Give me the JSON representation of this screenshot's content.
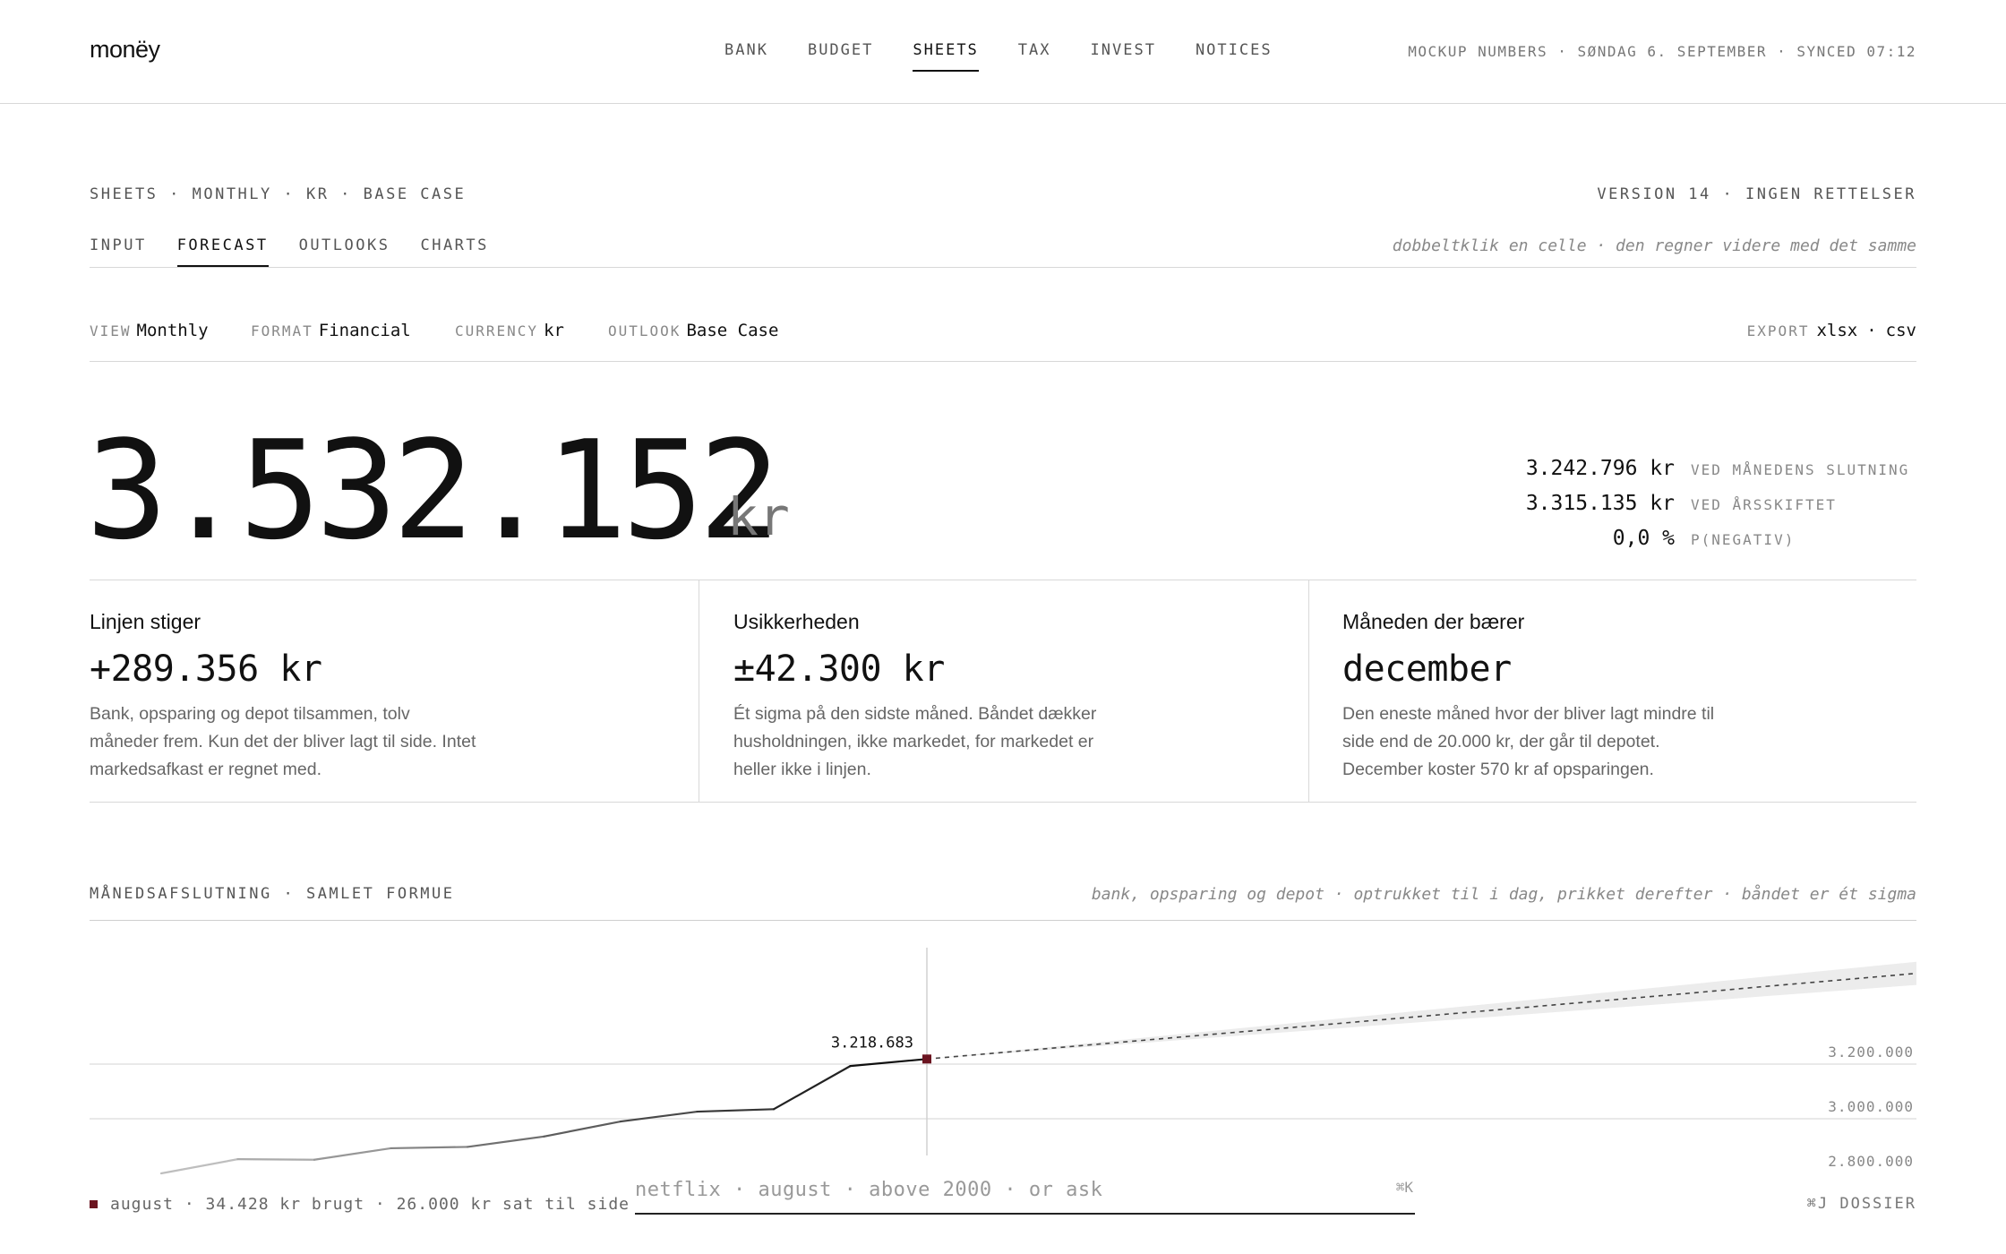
{
  "app": {
    "logo": "monëy",
    "nav": [
      "BANK",
      "BUDGET",
      "SHEETS",
      "TAX",
      "INVEST",
      "NOTICES"
    ],
    "nav_active": "SHEETS",
    "status": "MOCKUP NUMBERS · SØNDAG 6. SEPTEMBER · SYNCED 07:12"
  },
  "sheet": {
    "breadcrumb": "SHEETS · MONTHLY · KR · BASE CASE",
    "version": "VERSION 14 · INGEN RETTELSER",
    "tabs": [
      "INPUT",
      "FORECAST",
      "OUTLOOKS",
      "CHARTS"
    ],
    "active_tab": "FORECAST",
    "hint": "dobbeltklik en celle · den regner videre med det samme"
  },
  "controls": {
    "view": {
      "label": "VIEW",
      "value": "Monthly"
    },
    "format": {
      "label": "FORMAT",
      "value": "Financial"
    },
    "currency": {
      "label": "CURRENCY",
      "value": "kr"
    },
    "outlook": {
      "label": "OUTLOOK",
      "value": "Base Case"
    },
    "export": {
      "label": "EXPORT",
      "options": [
        "xlsx",
        "csv"
      ],
      "sep": "·"
    }
  },
  "headline": {
    "value": "3.532.152",
    "unit": "kr",
    "kpis": [
      {
        "value": "3.242.796 kr",
        "label": "VED MÅNEDENS SLUTNING"
      },
      {
        "value": "3.315.135 kr",
        "label": "VED ÅRSSKIFTET"
      },
      {
        "value": "0,0 %",
        "label": "P(NEGATIV)"
      }
    ]
  },
  "cards": [
    {
      "title": "Linjen stiger",
      "value": "+289.356 kr",
      "desc": "Bank, opsparing og depot tilsammen, tolv måneder frem. Kun det der bliver lagt til side. Intet markedsafkast er regnet med."
    },
    {
      "title": "Usikkerheden",
      "value": "±42.300 kr",
      "desc": "Ét sigma på den sidste måned. Båndet dækker husholdningen, ikke markedet, for markedet er heller ikke i linjen."
    },
    {
      "title": "Måneden der bærer",
      "value": "december",
      "desc": "Den eneste måned hvor der bliver lagt mindre til side end de 20.000 kr, der går til depotet. December koster 570 kr af opsparingen."
    }
  ],
  "chart": {
    "title": "MÅNEDSAFSLUTNING · SAMLET FORMUE",
    "note": "bank, opsparing og depot · optrukket til i dag, prikket derefter · båndet er ét sigma",
    "marker_label": "3.218.683",
    "accent": "#6b1420"
  },
  "chart_data": {
    "type": "line",
    "title": "MÅNEDSAFSLUTNING · SAMLET FORMUE",
    "y_ticks": [
      3000000,
      3200000
    ],
    "y_tick_labels": [
      "3.200.000",
      "3.000.000",
      "2.800.000"
    ],
    "actual": [
      2800000,
      2852000,
      2850000,
      2892000,
      2897000,
      2935000,
      2990000,
      3026000,
      3035000,
      3193000,
      3218683
    ],
    "forecast": [
      3218683,
      3242796,
      3267000,
      3291000,
      3315135,
      3339000,
      3363000,
      3387000,
      3411000,
      3435000,
      3459000,
      3484000,
      3508000,
      3532152
    ],
    "sigma_end": 42300,
    "ylim": [
      2780000,
      3640000
    ]
  },
  "footer": {
    "left": "august · 34.428 kr brugt · 26.000 kr sat til side",
    "search_placeholder": "netflix · august · above 2000 · or ask",
    "shortcut": "⌘K",
    "right": "⌘J DOSSIER"
  }
}
